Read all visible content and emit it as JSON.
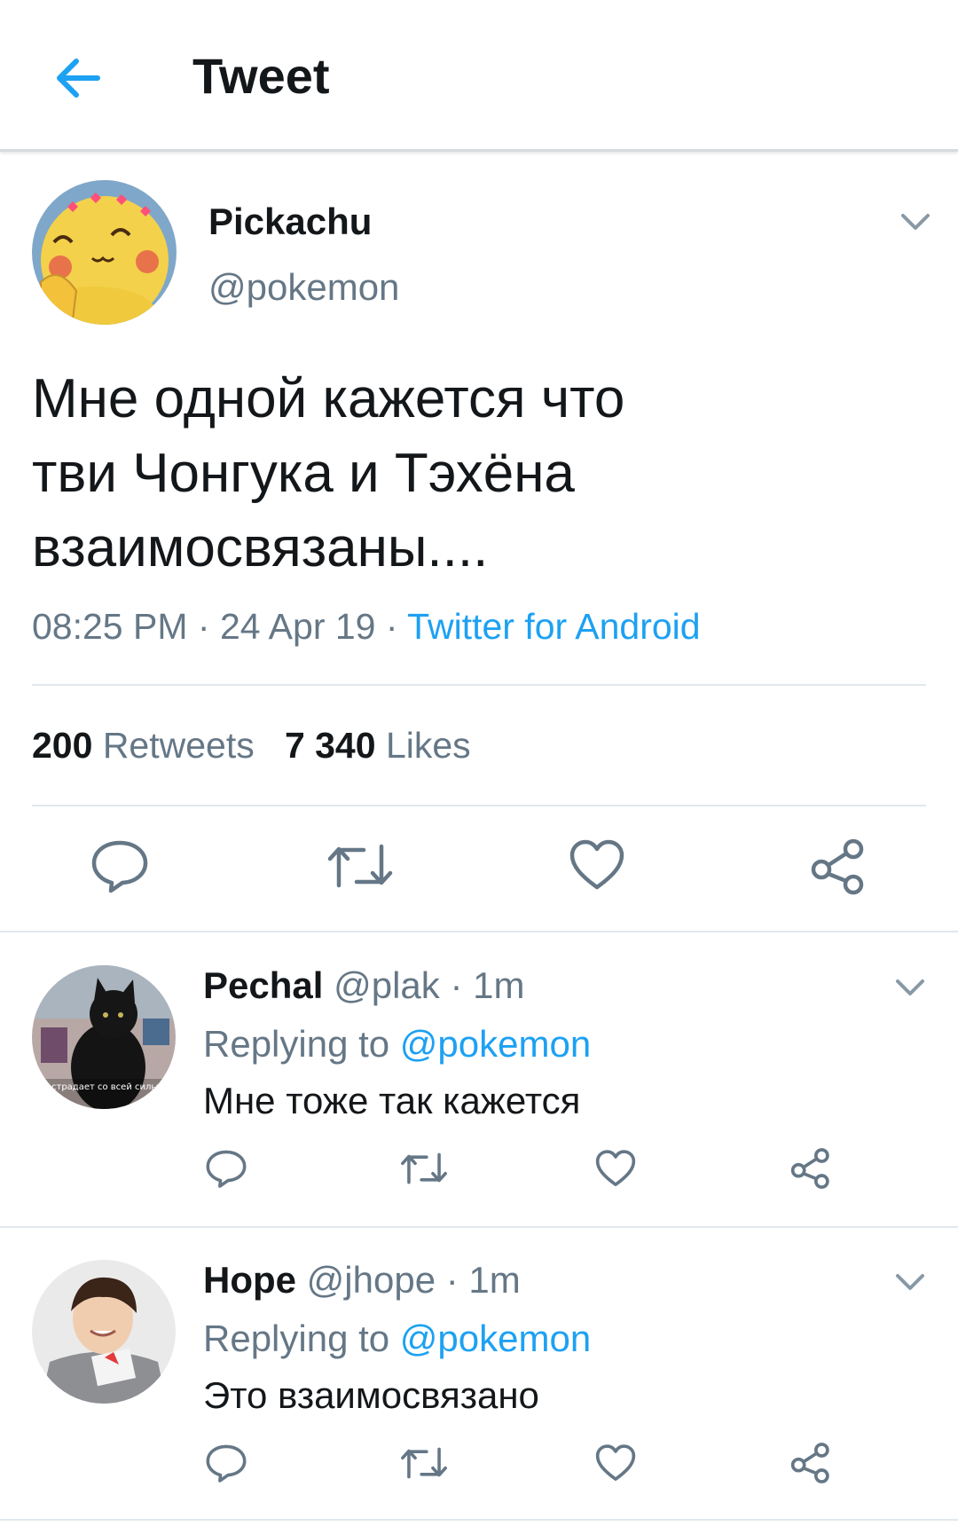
{
  "header": {
    "title": "Tweet"
  },
  "tweet": {
    "author_name": "Pickachu",
    "author_handle": "@pokemon",
    "text_lines": [
      "Мне одной кажется что",
      "тви Чонгука и Тэхёна",
      "взаимосвязаны...."
    ],
    "time": "08:25 PM",
    "separator": " · ",
    "date": "24 Apr 19",
    "source": "Twitter for Android",
    "retweets_count": "200",
    "retweets_label": "Retweets",
    "likes_count": "7 340",
    "likes_label": "Likes"
  },
  "replies": [
    {
      "name": "Pechal",
      "handle": "@plak",
      "time": " · 1m",
      "replying_prefix": "Replying to ",
      "replying_to": "@pokemon",
      "text": "Мне тоже так кажется",
      "avatar_caption": "страдает со всей силы"
    },
    {
      "name": "Hope",
      "handle": "@jhope",
      "time": " · 1m",
      "replying_prefix": "Replying to ",
      "replying_to": "@pokemon",
      "text": "Это взаимосвязано"
    }
  ],
  "colors": {
    "accent": "#1da1f2",
    "text": "#14171a",
    "secondary": "#657786",
    "divider": "#e1e8ed"
  },
  "icons": [
    "back-arrow-icon",
    "chevron-down-icon",
    "reply-icon",
    "retweet-icon",
    "like-icon",
    "share-icon"
  ]
}
